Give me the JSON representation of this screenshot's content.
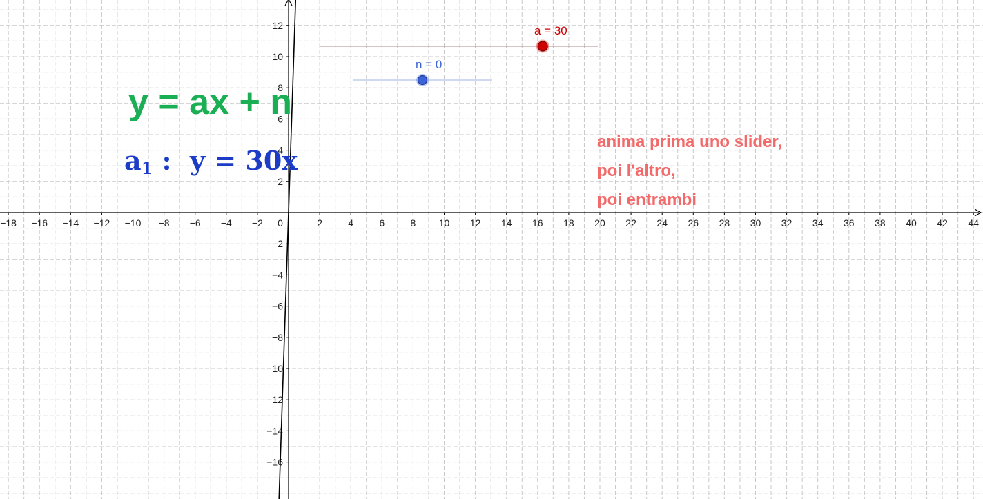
{
  "equation_title": "y = ax + n",
  "equation_line": {
    "name_base": "a",
    "name_sub": "1",
    "separator": " :  ",
    "expression": "y = 30x"
  },
  "instructions": {
    "line1": "anima prima uno slider,",
    "line2": "poi l'altro,",
    "line3": "poi entrambi"
  },
  "sliders": {
    "a": {
      "label": "a = 30",
      "color": "#cc0000",
      "value_fraction": 0.8
    },
    "n": {
      "label": "n = 0",
      "color": "#3c64d8",
      "value_fraction": 0.5
    }
  },
  "axes": {
    "x_ticks": [
      "-18",
      "-16",
      "-14",
      "-12",
      "-10",
      "-8",
      "-6",
      "-4",
      "-2",
      "0",
      "2",
      "4",
      "6",
      "8",
      "10",
      "12",
      "14",
      "16",
      "18",
      "20",
      "22",
      "24",
      "26",
      "28",
      "30",
      "32",
      "34",
      "36",
      "38",
      "40",
      "42",
      "44"
    ],
    "y_ticks": [
      "12",
      "10",
      "8",
      "6",
      "4",
      "2",
      "-2",
      "-4",
      "-6",
      "-8",
      "-10",
      "-12",
      "-14",
      "-16"
    ],
    "grid": true
  },
  "line": {
    "slope": 30,
    "intercept": 0,
    "color": "#000000"
  }
}
